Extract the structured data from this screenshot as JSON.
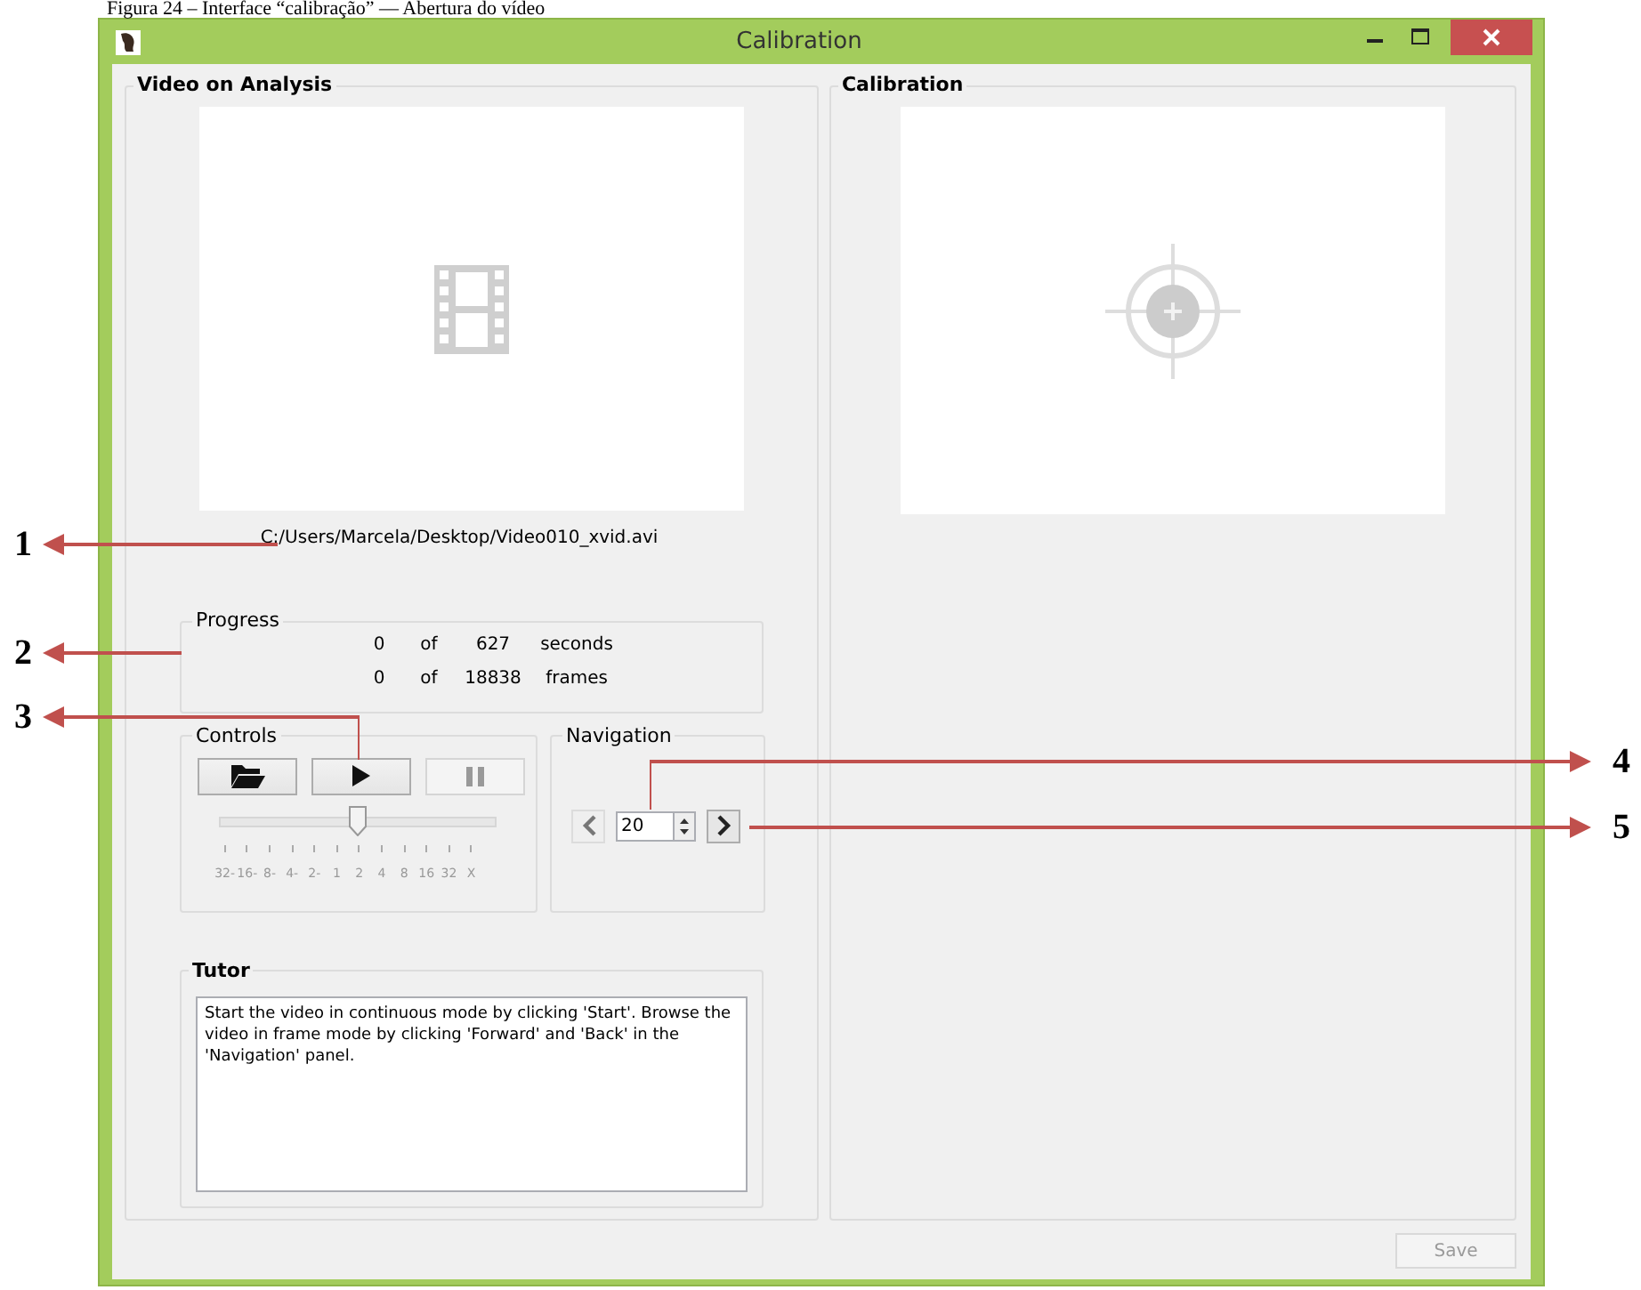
{
  "caption": "Figura 24 – Interface “calibração” — Abertura do vídeo",
  "window": {
    "title": "Calibration"
  },
  "video_group": {
    "title": "Video on Analysis",
    "file_path": "C:/Users/Marcela/Desktop/Video010_xvid.avi"
  },
  "progress": {
    "title": "Progress",
    "rows": [
      {
        "current": "0",
        "of": "of",
        "total": "627",
        "unit": "seconds"
      },
      {
        "current": "0",
        "of": "of",
        "total": "18838",
        "unit": "frames"
      }
    ]
  },
  "controls": {
    "title": "Controls",
    "buttons": [
      {
        "kind": "open",
        "disabled": false
      },
      {
        "kind": "play",
        "disabled": false
      },
      {
        "kind": "pause",
        "disabled": true
      }
    ],
    "speed_slider": {
      "level": 0.5,
      "ticks": [
        "32-",
        "16-",
        "8-",
        "4-",
        "2-",
        "1",
        "2",
        "4",
        "8",
        "16",
        "32",
        "X"
      ]
    }
  },
  "navigation": {
    "title": "Navigation",
    "back": {
      "disabled": true
    },
    "frame_step": "20",
    "forward": {
      "disabled": false
    }
  },
  "tutor": {
    "title": "Tutor",
    "text": "Start the video in continuous mode by clicking 'Start'. Browse the video in frame mode by clicking 'Forward' and 'Back' in the 'Navigation' panel."
  },
  "calibration_group": {
    "title": "Calibration"
  },
  "save": {
    "label": "Save",
    "disabled": true
  },
  "annotations": [
    {
      "label": "1"
    },
    {
      "label": "2"
    },
    {
      "label": "3"
    },
    {
      "label": "4"
    },
    {
      "label": "5"
    }
  ]
}
